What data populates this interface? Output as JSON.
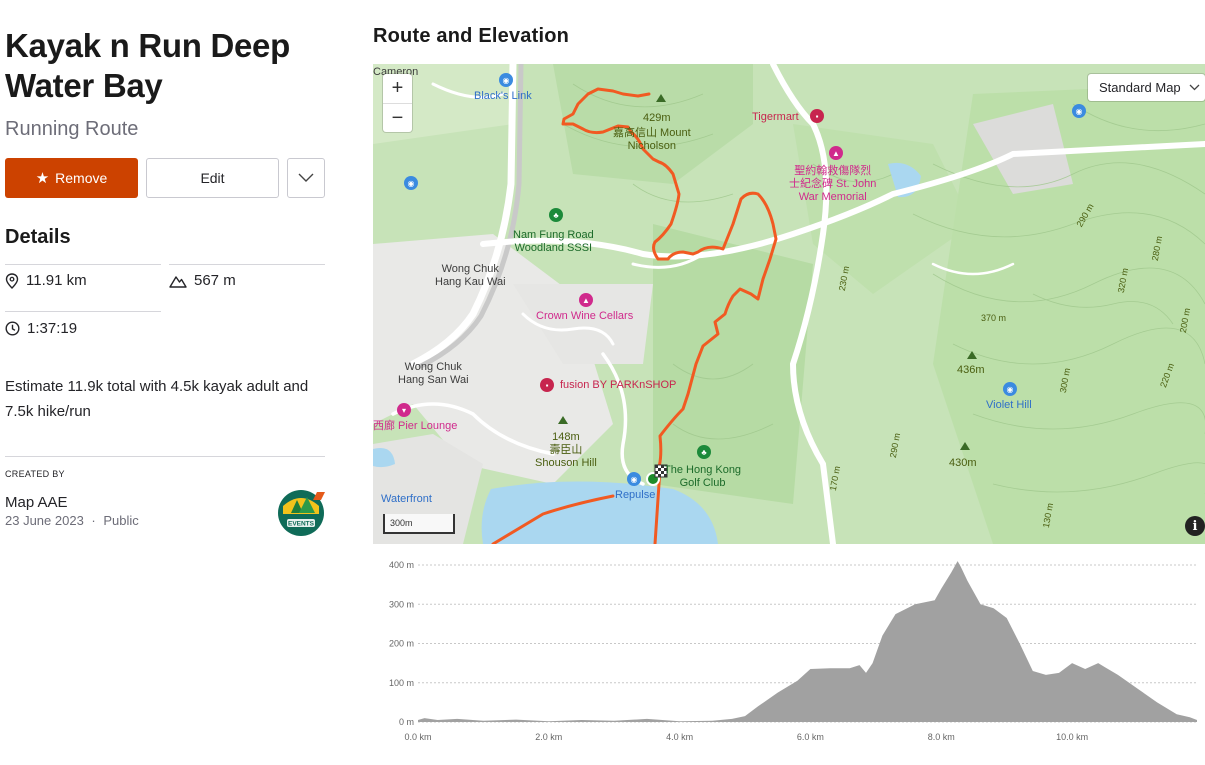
{
  "route": {
    "title": "Kayak n Run Deep Water Bay",
    "subtitle": "Running Route"
  },
  "actions": {
    "remove_label": "Remove",
    "edit_label": "Edit",
    "more_icon": "chevron-down-icon"
  },
  "details": {
    "heading": "Details",
    "distance": "11.91 km",
    "elevation_gain": "567 m",
    "moving_time": "1:37:19",
    "description": "Estimate 11.9k total with 4.5k kayak adult and 7.5k hike/run"
  },
  "creator": {
    "heading": "CREATED BY",
    "name": "Map AAE",
    "date": "23 June 2023",
    "separator": "·",
    "visibility": "Public",
    "avatar_text": "EVENTS"
  },
  "map_section": {
    "heading": "Route and Elevation",
    "zoom_in": "+",
    "zoom_out": "−",
    "map_type": "Standard Map",
    "scale_label": "300m",
    "info_icon": "i",
    "labels": {
      "cameron": "Cameron",
      "blacks_link": "Black's Link",
      "peak_429": "429m",
      "mount_nicholson": "嘉高信山 Mount\nNicholson",
      "tigermart": "Tigermart",
      "war_memorial": "聖約翰救傷隊烈\n士紀念碑 St. John\nWar Memorial",
      "nam_fung": "Nam Fung Road\nWoodland SSSI",
      "wong_chuk_hang_kau_wai": "Wong Chuk\nHang Kau Wai",
      "crown_wine": "Crown Wine Cellars",
      "wong_chuk_hang_san_wai": "Wong Chuk\nHang San Wai",
      "fusion": "fusion BY PARKnSHOP",
      "pier_lounge": "Pier Lounge",
      "xi_lang": "西廊",
      "peak_148": "148m\n壽臣山\nShouson Hill",
      "repulse": "Repulse",
      "golf_club": "The Hong Kong\nGolf Club",
      "waterfront": "Waterfront",
      "peak_436": "436m",
      "violet_hill": "Violet Hill",
      "peak_430": "430m",
      "c_370": "370 m",
      "c_320": "320 m",
      "c_300": "300 m",
      "c_290": "290 m",
      "c_280": "280 m",
      "c_230": "230 m",
      "c_220": "220 m",
      "c_200": "200 m",
      "c_170": "170 m",
      "c_130": "130 m"
    }
  },
  "chart_data": {
    "type": "area",
    "title": "",
    "xlabel": "",
    "ylabel": "",
    "x_unit": "km",
    "y_unit": "m",
    "xlim": [
      0,
      11.91
    ],
    "ylim": [
      0,
      400
    ],
    "x_ticks": [
      "0.0 km",
      "2.0 km",
      "4.0 km",
      "6.0 km",
      "8.0 km",
      "10.0 km"
    ],
    "y_ticks": [
      "0 m",
      "100 m",
      "200 m",
      "300 m",
      "400 m"
    ],
    "grid": true,
    "series": [
      {
        "color": "#a1a1a1",
        "x": [
          0,
          0.1,
          0.3,
          0.6,
          1.0,
          1.5,
          2.0,
          2.5,
          3.0,
          3.5,
          4.0,
          4.5,
          4.8,
          5.0,
          5.2,
          5.5,
          5.8,
          6.0,
          6.3,
          6.6,
          6.75,
          6.85,
          6.95,
          7.1,
          7.3,
          7.6,
          7.9,
          8.0,
          8.15,
          8.25,
          8.3,
          8.4,
          8.6,
          8.8,
          9.0,
          9.2,
          9.4,
          9.6,
          9.8,
          10.0,
          10.2,
          10.4,
          10.5,
          10.7,
          11.0,
          11.3,
          11.6,
          11.8,
          11.91
        ],
        "y": [
          5,
          10,
          5,
          8,
          3,
          6,
          2,
          5,
          3,
          8,
          2,
          3,
          8,
          15,
          40,
          75,
          105,
          135,
          137,
          137,
          145,
          125,
          150,
          220,
          275,
          300,
          310,
          340,
          380,
          410,
          395,
          360,
          300,
          290,
          265,
          200,
          130,
          120,
          125,
          150,
          135,
          150,
          140,
          120,
          85,
          50,
          20,
          12,
          5
        ]
      }
    ]
  }
}
